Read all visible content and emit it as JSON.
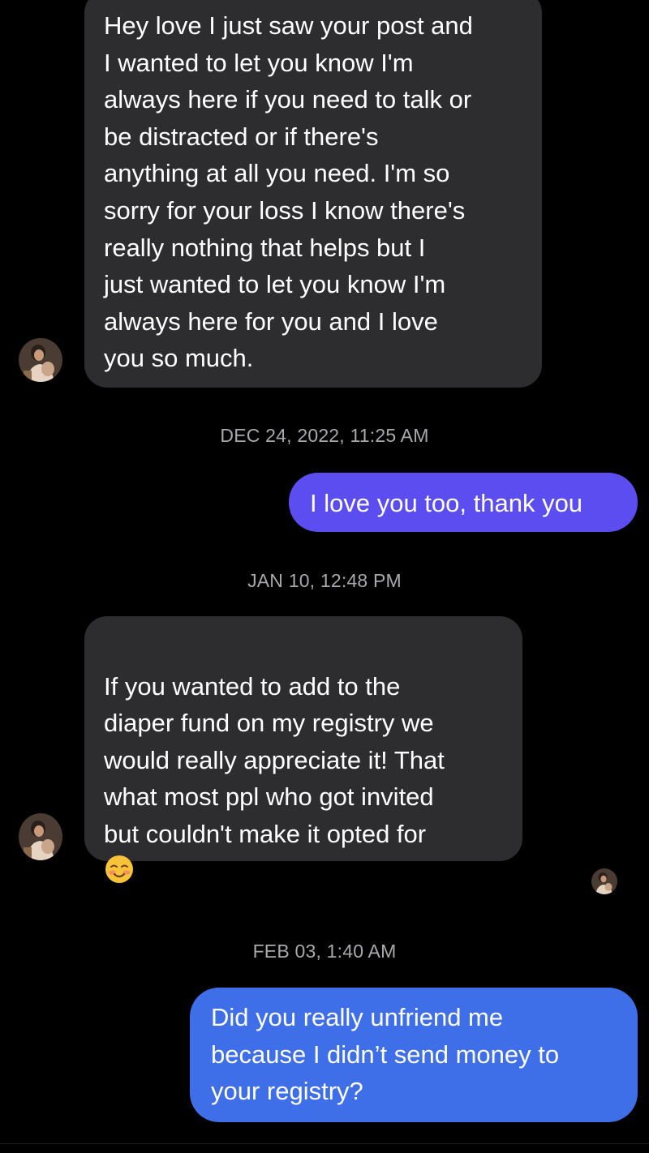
{
  "colors": {
    "background": "#000000",
    "incoming_bubble": "#2d2d2f",
    "outgoing_bubble_1": "#5b4df0",
    "outgoing_bubble_2": "#3f6fe8",
    "timestamp_text": "#a9a9ad"
  },
  "messages": [
    {
      "direction": "incoming",
      "text": "Hey love I just saw your post and\nI wanted to let you know I'm\nalways here if you need to talk or\nbe distracted or if there's\nanything at all you need. I'm so\nsorry for your loss I know there's\nreally nothing that helps  but I\njust wanted to let you know I'm\nalways here for you and I love\nyou so much."
    },
    {
      "direction": "outgoing",
      "text": "I love you too, thank you"
    },
    {
      "direction": "incoming",
      "text": "If you wanted to add to the\ndiaper fund on my registry we\nwould really appreciate it! That\nwhat most ppl who got invited\nbut couldn't make it opted for\n",
      "emoji": "smiling-face-with-blush-icon"
    },
    {
      "direction": "outgoing",
      "text": "Did you really unfriend me\nbecause I didn’t send money to\nyour registry?"
    }
  ],
  "timestamps": [
    "DEC 24, 2022, 11:25 AM",
    "JAN 10, 12:48 PM",
    "FEB 03, 1:40 AM"
  ]
}
